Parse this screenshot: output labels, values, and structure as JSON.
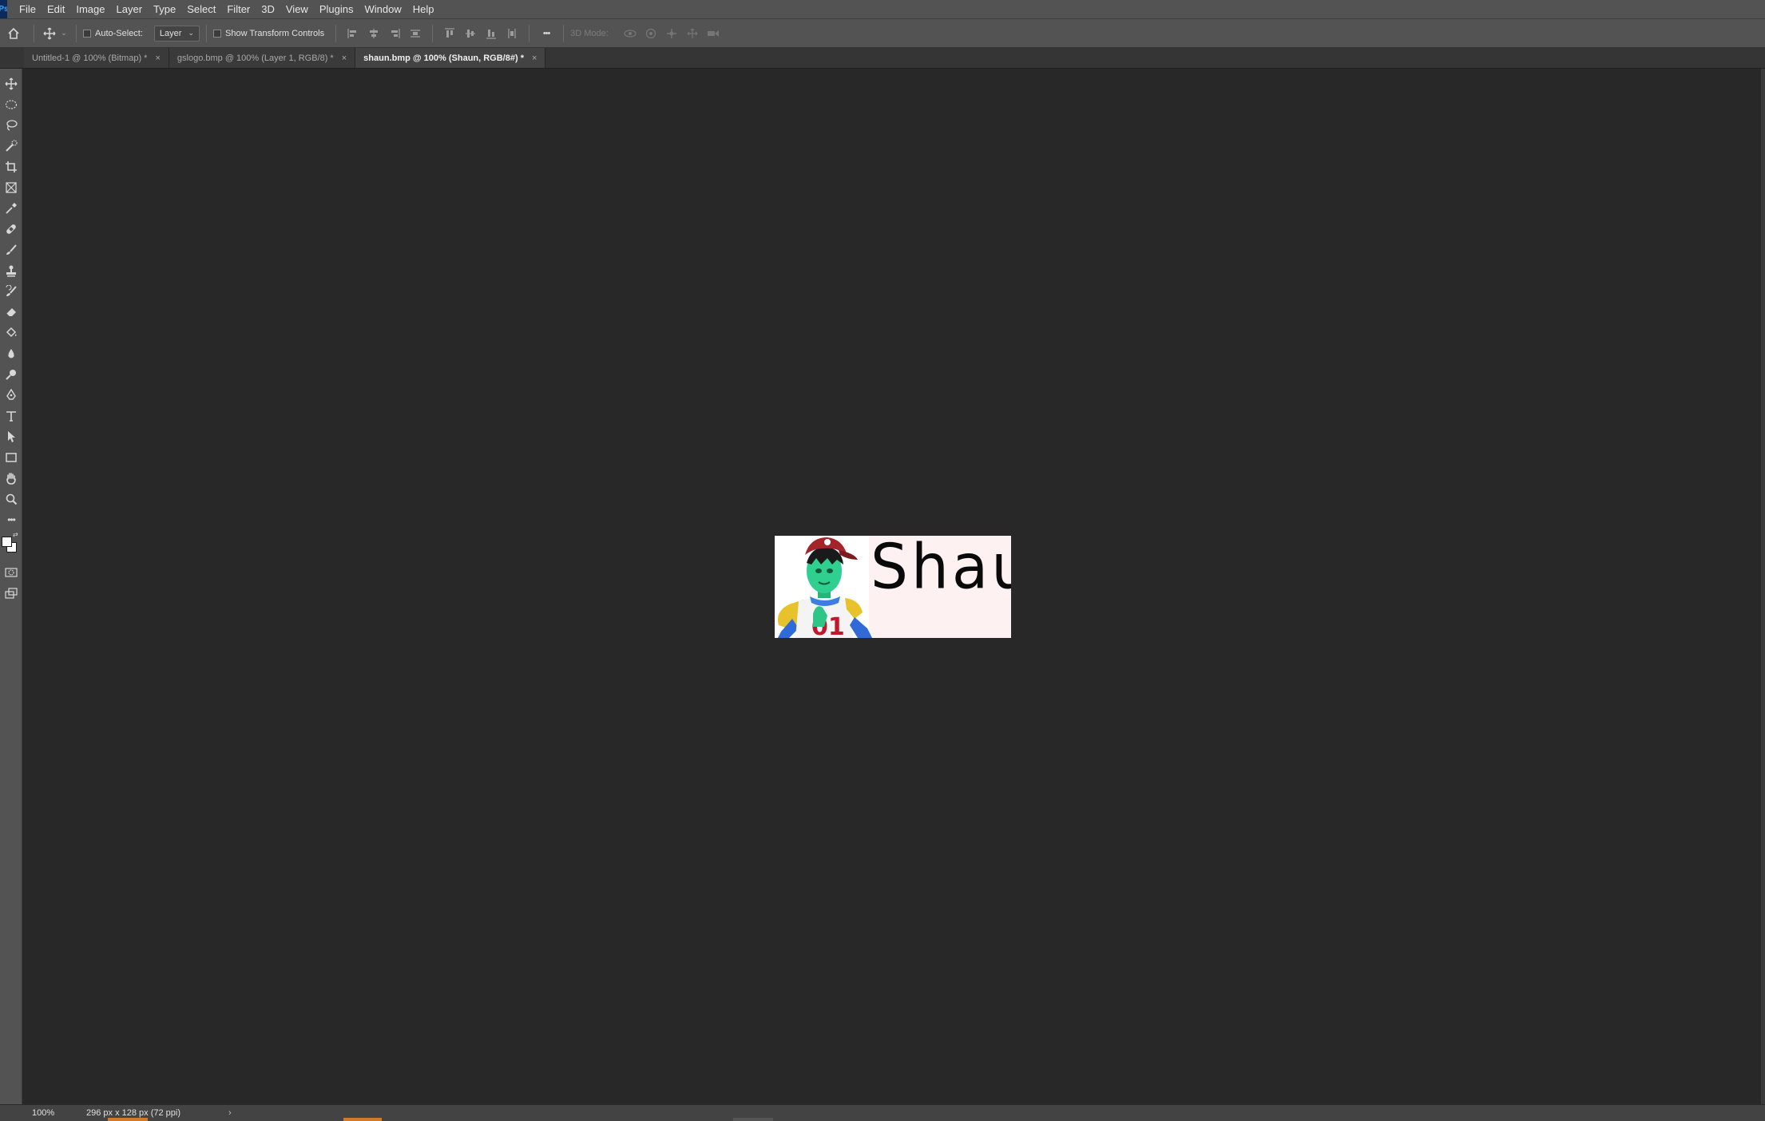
{
  "app": {
    "logo_text": "Ps"
  },
  "menu": {
    "items": [
      "File",
      "Edit",
      "Image",
      "Layer",
      "Type",
      "Select",
      "Filter",
      "3D",
      "View",
      "Plugins",
      "Window",
      "Help"
    ]
  },
  "options": {
    "auto_select_label": "Auto-Select:",
    "layer_select_value": "Layer",
    "show_transform_label": "Show Transform Controls",
    "mode_3d_label": "3D Mode:",
    "more_glyph": "•••"
  },
  "tabs": [
    {
      "label": "Untitled-1 @ 100% (Bitmap) *",
      "active": false
    },
    {
      "label": "gslogo.bmp @ 100% (Layer 1, RGB/8) *",
      "active": false
    },
    {
      "label": "shaun.bmp @ 100% (Shaun, RGB/8#) *",
      "active": true
    }
  ],
  "tab_close_glyph": "×",
  "document": {
    "text": "Shaun"
  },
  "status": {
    "zoom": "100%",
    "doc_info": "296 px x 128 px (72 ppi)",
    "arrow": "›"
  }
}
